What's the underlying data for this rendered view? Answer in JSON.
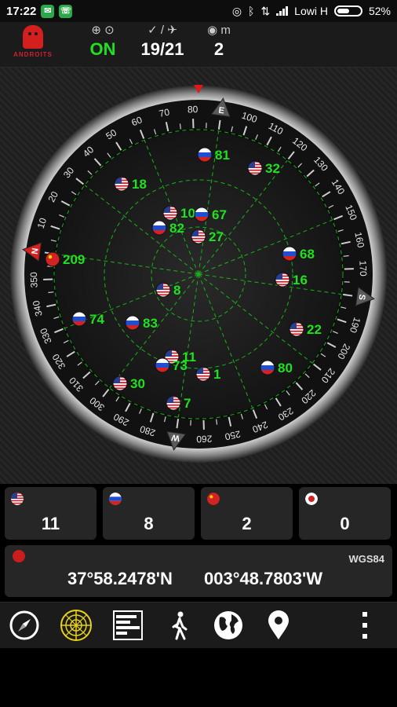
{
  "statusbar": {
    "time": "17:22",
    "carrier": "Lowi H",
    "battery": "52%",
    "battery_level": 0.52
  },
  "app": {
    "logo_text": "ANDROITS",
    "gps_status": "ON",
    "satellites": "19/21",
    "accuracy": "2",
    "accuracy_unit": "m"
  },
  "compass": {
    "cardinals": {
      "north": "N",
      "east": "E",
      "south": "S",
      "west": "W"
    },
    "rose_heading_deg": 82,
    "degree_labels": [
      "10",
      "20",
      "30",
      "40",
      "50",
      "60",
      "70",
      "80",
      "100",
      "110",
      "120",
      "130",
      "140",
      "150",
      "160",
      "170",
      "190",
      "200",
      "210",
      "220",
      "230",
      "240",
      "250",
      "260",
      "280",
      "290",
      "300",
      "310",
      "320",
      "330",
      "340",
      "350"
    ]
  },
  "satellites": [
    {
      "id": "81",
      "flag": "ru"
    },
    {
      "id": "32",
      "flag": "us"
    },
    {
      "id": "18",
      "flag": "us"
    },
    {
      "id": "10",
      "flag": "us"
    },
    {
      "id": "67",
      "flag": "ru"
    },
    {
      "id": "82",
      "flag": "ru"
    },
    {
      "id": "27",
      "flag": "us"
    },
    {
      "id": "68",
      "flag": "ru"
    },
    {
      "id": "209",
      "flag": "cn"
    },
    {
      "id": "16",
      "flag": "us"
    },
    {
      "id": "8",
      "flag": "us"
    },
    {
      "id": "74",
      "flag": "ru"
    },
    {
      "id": "83",
      "flag": "ru"
    },
    {
      "id": "22",
      "flag": "us"
    },
    {
      "id": "11",
      "flag": "us"
    },
    {
      "id": "73",
      "flag": "ru"
    },
    {
      "id": "1",
      "flag": "us"
    },
    {
      "id": "80",
      "flag": "ru"
    },
    {
      "id": "30",
      "flag": "us"
    },
    {
      "id": "7",
      "flag": "us"
    }
  ],
  "constellations": [
    {
      "name": "gps",
      "flag": "us",
      "count": "11"
    },
    {
      "name": "glonass",
      "flag": "ru",
      "count": "8"
    },
    {
      "name": "beidou",
      "flag": "cn",
      "count": "2"
    },
    {
      "name": "qzss",
      "flag": "jp",
      "count": "0"
    }
  ],
  "location": {
    "datum": "WGS84",
    "latitude": "37°58.2478'N",
    "longitude": "003°48.7803'W"
  },
  "nav": [
    "compass",
    "radar",
    "signal-bars",
    "walker",
    "globe",
    "map-pin",
    "more"
  ],
  "colors": {
    "accent_green": "#20e020",
    "flag_red": "#d22222",
    "background": "#000000"
  }
}
